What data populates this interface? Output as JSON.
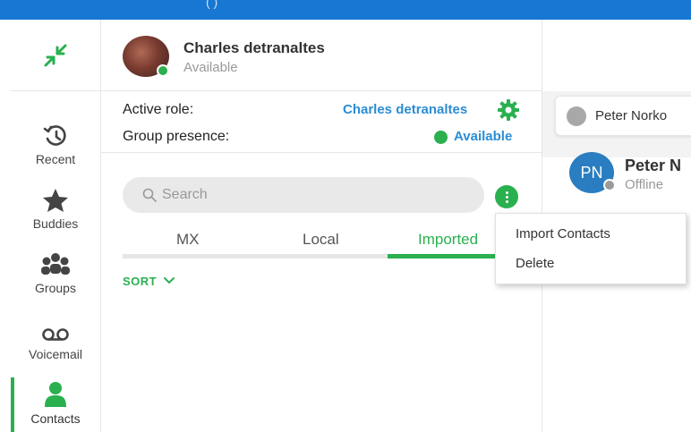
{
  "titlebar": {
    "text": "(             )"
  },
  "nav": {
    "items": [
      {
        "label": "Recent",
        "icon": "history-icon"
      },
      {
        "label": "Buddies",
        "icon": "star-icon"
      },
      {
        "label": "Groups",
        "icon": "group-icon"
      },
      {
        "label": "Voicemail",
        "icon": "voicemail-icon"
      },
      {
        "label": "Contacts",
        "icon": "person-icon"
      }
    ],
    "active": "Contacts"
  },
  "user": {
    "name": "Charles detranaltes",
    "status": "Available"
  },
  "role": {
    "active_role_label": "Active role:",
    "active_role_value": "Charles detranaltes",
    "group_presence_label": "Group presence:",
    "group_presence_value": "Available"
  },
  "search": {
    "placeholder": "Search"
  },
  "tabs": [
    "MX",
    "Local",
    "Imported"
  ],
  "active_tab": "Imported",
  "sort": {
    "label": "SORT"
  },
  "menu": {
    "items": [
      "Import Contacts",
      "Delete"
    ]
  },
  "right": {
    "tab_name": "Peter Norko",
    "avatar_initials": "PN",
    "contact_name": "Peter N",
    "contact_status": "Offline"
  },
  "colors": {
    "accent": "#2ab04f",
    "link": "#2a8dd4",
    "titlebar": "#1877d2"
  }
}
